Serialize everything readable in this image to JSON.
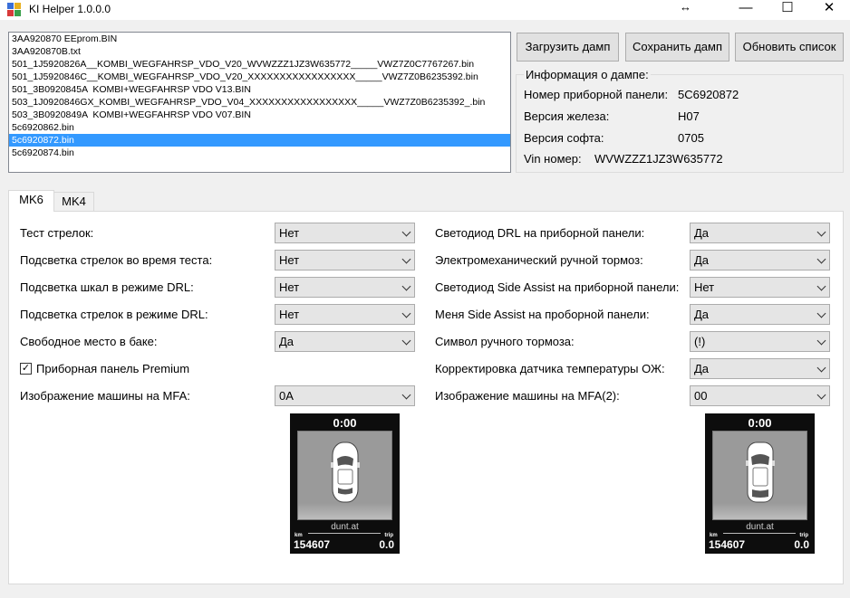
{
  "window": {
    "title": "KI Helper 1.0.0.0",
    "resize_glyph": "↔",
    "minimize": "—",
    "maximize": "☐",
    "close": "✕"
  },
  "files": [
    "3AA920870 EEprom.BIN",
    "3AA920870B.txt",
    "501_1J5920826A__KOMBI_WEGFAHRSP_VDO_V20_WVWZZZ1JZ3W635772_____VWZ7Z0C7767267.bin",
    "501_1J5920846C__KOMBI_WEGFAHRSP_VDO_V20_XXXXXXXXXXXXXXXXX_____VWZ7Z0B6235392.bin",
    "501_3B0920845A  KOMBI+WEGFAHRSP VDO V13.BIN",
    "503_1J0920846GX_KOMBI_WEGFAHRSP_VDO_V04_XXXXXXXXXXXXXXXXX_____VWZ7Z0B6235392_.bin",
    "503_3B0920849A  KOMBI+WEGFAHRSP VDO V07.BIN",
    "5c6920862.bin",
    "5c6920872.bin",
    "5c6920874.bin"
  ],
  "selected_file_index": 8,
  "buttons": {
    "load": "Загрузить дамп",
    "save": "Сохранить дамп",
    "refresh": "Обновить список"
  },
  "info": {
    "title": "Информация о дампе:",
    "panel_label": "Номер приборной панели:",
    "panel_value": "5C6920872",
    "hw_label": "Версия железа:",
    "hw_value": "H07",
    "sw_label": "Версия софта:",
    "sw_value": "0705",
    "vin_label": "Vin номер:",
    "vin_value": "WVWZZZ1JZ3W635772"
  },
  "tabs": [
    "MK6",
    "MK4"
  ],
  "active_tab": "MK6",
  "left_settings": [
    {
      "label": "Тест стрелок:",
      "value": "Нет"
    },
    {
      "label": "Подсветка стрелок во время теста:",
      "value": "Нет"
    },
    {
      "label": "Подсветка шкал в режиме DRL:",
      "value": "Нет"
    },
    {
      "label": "Подсветка стрелок в режиме DRL:",
      "value": "Нет"
    },
    {
      "label": "Свободное место в баке:",
      "value": "Да"
    }
  ],
  "premium_checkbox": {
    "label": "Приборная панель Premium",
    "checked": true,
    "mark": "✓"
  },
  "left_mfa": {
    "label": "Изображение машины на MFA:",
    "value": "0A"
  },
  "right_settings": [
    {
      "label": "Светодиод DRL на приборной панели:",
      "value": "Да"
    },
    {
      "label": "Электромеханический ручной тормоз:",
      "value": "Да"
    },
    {
      "label": "Светодиод Side Assist на приборной панели:",
      "value": "Нет"
    },
    {
      "label": "Меня Side Assist на проборной панели:",
      "value": "Да"
    },
    {
      "label": "Символ ручного тормоза:",
      "value": "(!)"
    },
    {
      "label": "Корректировка датчика температуры ОЖ:",
      "value": "Да"
    },
    {
      "label": "Изображение машины на MFA(2):",
      "value": "00"
    }
  ],
  "displays": [
    {
      "clock": "0:00",
      "brand": "dunt.at",
      "km_label": "km",
      "trip_label": "trip",
      "km": "154607",
      "trip": "0.0"
    },
    {
      "clock": "0:00",
      "brand": "dunt.at",
      "km_label": "km",
      "trip_label": "trip",
      "km": "154607",
      "trip": "0.0"
    }
  ],
  "colors": {
    "selection": "#3399ff",
    "window_bg": "#f0f0f0",
    "panel_bg": "#ffffff"
  }
}
